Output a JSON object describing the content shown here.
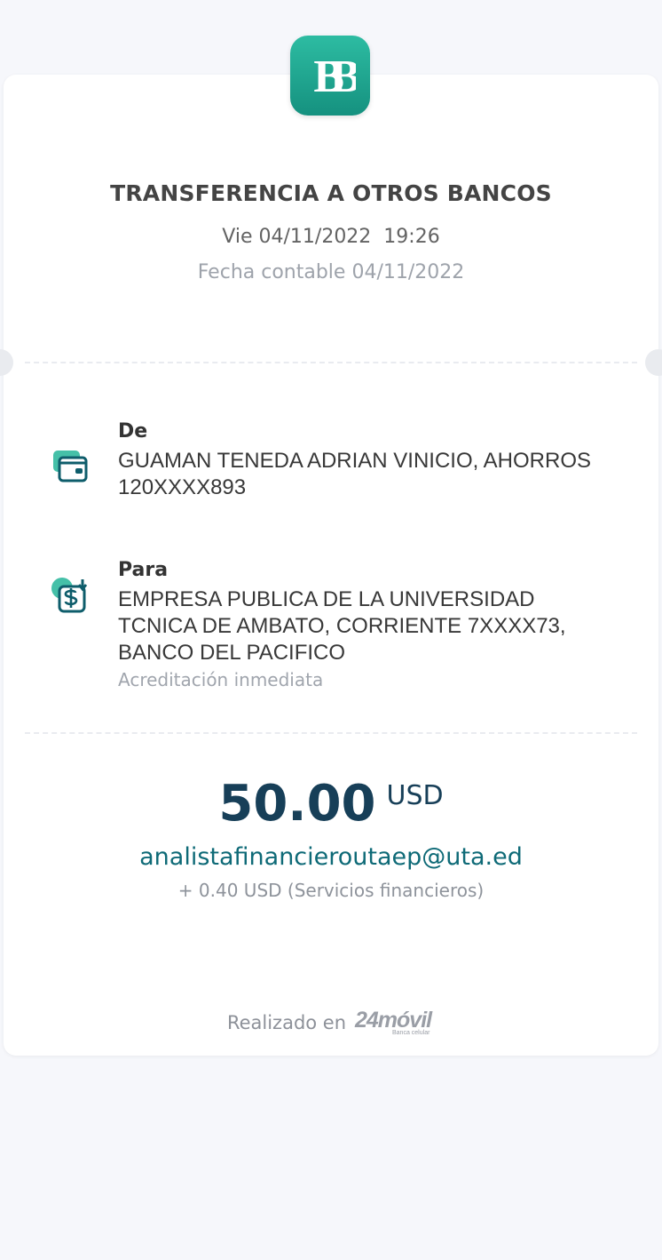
{
  "header": {
    "title": "TRANSFERENCIA A OTROS BANCOS",
    "datetime": "Vie 04/11/2022  19:26",
    "fecha_contable": "Fecha contable 04/11/2022"
  },
  "from": {
    "label": "De",
    "value": "GUAMAN TENEDA ADRIAN VINICIO, AHORROS 120XXXX893",
    "icon": "wallet-icon"
  },
  "to": {
    "label": "Para",
    "value": "EMPRESA PUBLICA DE LA UNIVERSIDAD TCNICA DE AMBATO, CORRIENTE 7XXXX73, BANCO DEL PACIFICO",
    "note": "Acreditación inmediata",
    "icon": "money-transfer-icon"
  },
  "amount": {
    "value": "50.00",
    "currency": "USD",
    "email": "analistafinancieroutaep@uta.ed",
    "fee": "+ 0.40 USD (Servicios financieros)"
  },
  "footer": {
    "text": "Realizado en",
    "brand": "24móvil",
    "brand_sub": "Banca celular"
  },
  "colors": {
    "accent": "#16a08a",
    "amount": "#173f58",
    "email": "#0e6a77",
    "background": "#f6f7fb"
  }
}
